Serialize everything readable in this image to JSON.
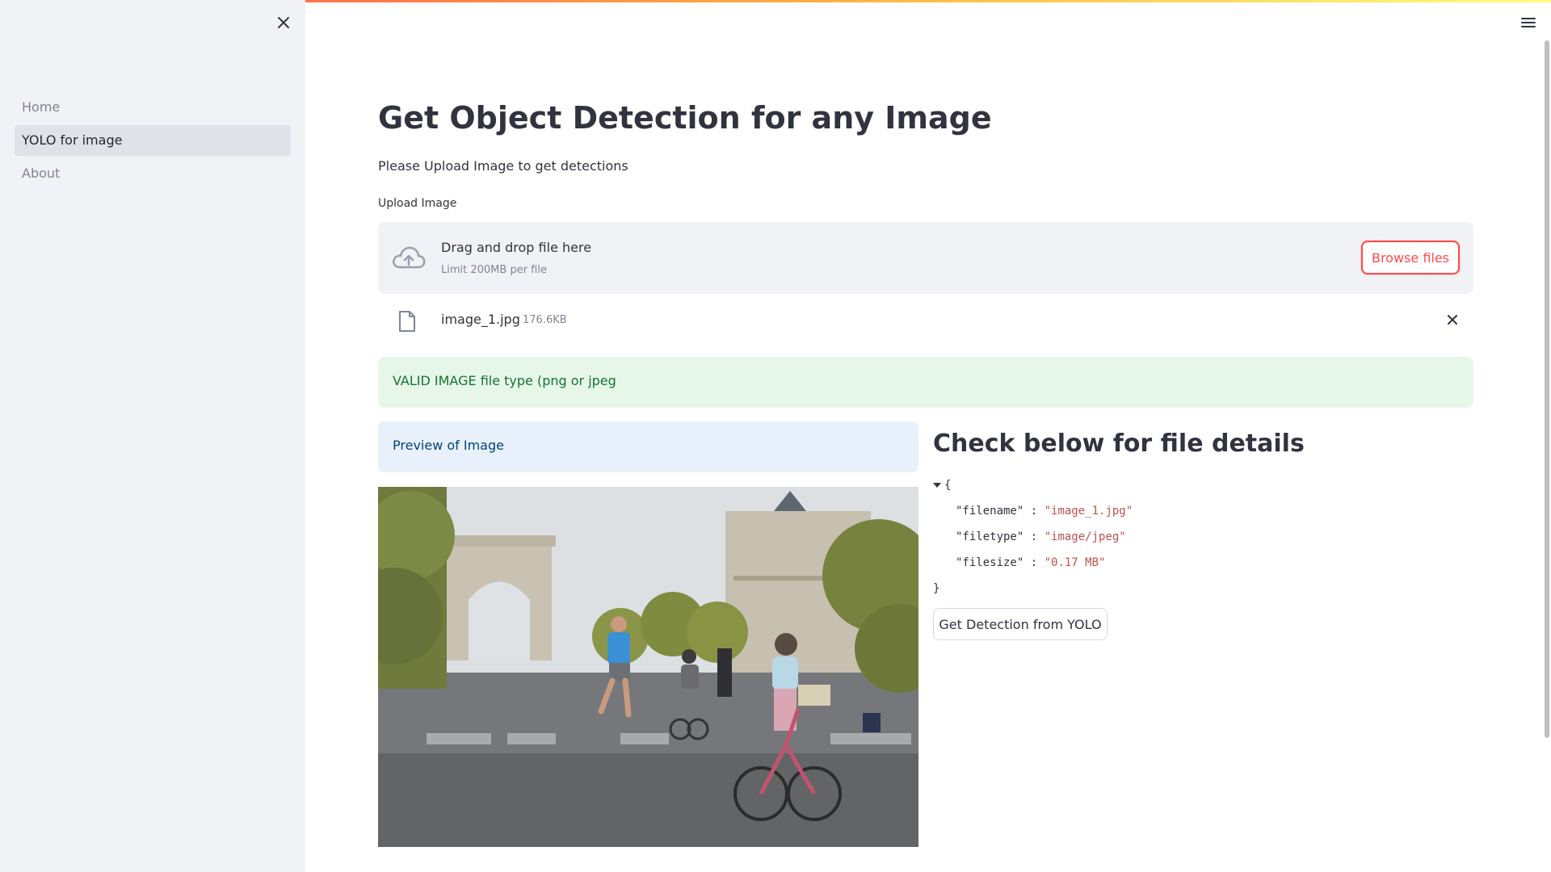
{
  "sidebar": {
    "items": [
      {
        "label": "Home",
        "active": false
      },
      {
        "label": "YOLO for image",
        "active": true
      },
      {
        "label": "About",
        "active": false
      }
    ]
  },
  "main": {
    "title": "Get Object Detection for any Image",
    "subtitle": "Please Upload Image to get detections",
    "upload": {
      "label": "Upload Image",
      "drop_text": "Drag and drop file here",
      "limit_text": "Limit 200MB per file",
      "browse_label": "Browse files"
    },
    "file": {
      "name": "image_1.jpg",
      "size": "176.6KB"
    },
    "success_message": "VALID IMAGE file type (png or jpeg",
    "preview_label": "Preview of Image",
    "details": {
      "title": "Check below for file details",
      "open_brace": "{",
      "close_brace": "}",
      "entries": [
        {
          "key": "\"filename\"",
          "value": "\"image_1.jpg\""
        },
        {
          "key": "\"filetype\"",
          "value": "\"image/jpeg\""
        },
        {
          "key": "\"filesize\"",
          "value": "\"0.17 MB\""
        }
      ]
    },
    "detect_button": "Get Detection from YOLO"
  },
  "colors": {
    "accent": "#ff4b4b",
    "success_bg": "#e6f7ea",
    "info_bg": "#e8f1fb"
  },
  "icons": [
    "close-icon",
    "hamburger-menu-icon",
    "cloud-upload-icon",
    "file-icon",
    "remove-file-icon",
    "chevron-down-icon"
  ]
}
